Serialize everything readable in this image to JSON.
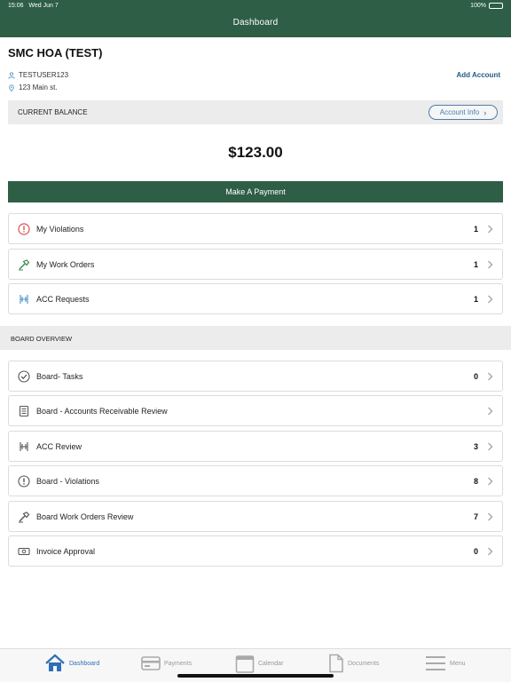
{
  "status": {
    "time": "15:06",
    "date": "Wed Jun 7",
    "battery": "100%"
  },
  "header": {
    "title": "Dashboard"
  },
  "association": {
    "name": "SMC HOA (TEST)",
    "username": "TESTUSER123",
    "address": "123 Main st."
  },
  "add_account_label": "Add Account",
  "balance": {
    "label": "CURRENT BALANCE",
    "account_info_label": "Account Info",
    "amount": "$123.00"
  },
  "pay_button_label": "Make A Payment",
  "my_items": [
    {
      "label": "My Violations",
      "count": "1",
      "icon": "alert-circle-icon"
    },
    {
      "label": "My Work Orders",
      "count": "1",
      "icon": "hammer-icon"
    },
    {
      "label": "ACC Requests",
      "count": "1",
      "icon": "architecture-icon"
    }
  ],
  "board_overview_label": "BOARD OVERVIEW",
  "board_items": [
    {
      "label": "Board- Tasks",
      "count": "0",
      "icon": "check-circle-icon"
    },
    {
      "label": "Board - Accounts Receivable Review",
      "count": "",
      "icon": "ledger-icon"
    },
    {
      "label": "ACC Review",
      "count": "3",
      "icon": "architecture-icon"
    },
    {
      "label": "Board - Violations",
      "count": "8",
      "icon": "alert-circle-icon"
    },
    {
      "label": "Board Work Orders Review",
      "count": "7",
      "icon": "hammer-icon"
    },
    {
      "label": "Invoice Approval",
      "count": "0",
      "icon": "money-icon"
    }
  ],
  "tabs": [
    {
      "label": "Dashboard",
      "icon": "home-icon",
      "active": true
    },
    {
      "label": "Payments",
      "icon": "credit-card-icon",
      "active": false
    },
    {
      "label": "Calendar",
      "icon": "calendar-icon",
      "active": false
    },
    {
      "label": "Documents",
      "icon": "document-icon",
      "active": false
    },
    {
      "label": "Menu",
      "icon": "menu-icon",
      "active": false
    }
  ],
  "colors": {
    "brand_green": "#2e5e45",
    "link_blue": "#1f5b87",
    "tab_active": "#2f6fb7",
    "alert_red": "#d9534f",
    "accent_blue": "#4a90c8"
  }
}
